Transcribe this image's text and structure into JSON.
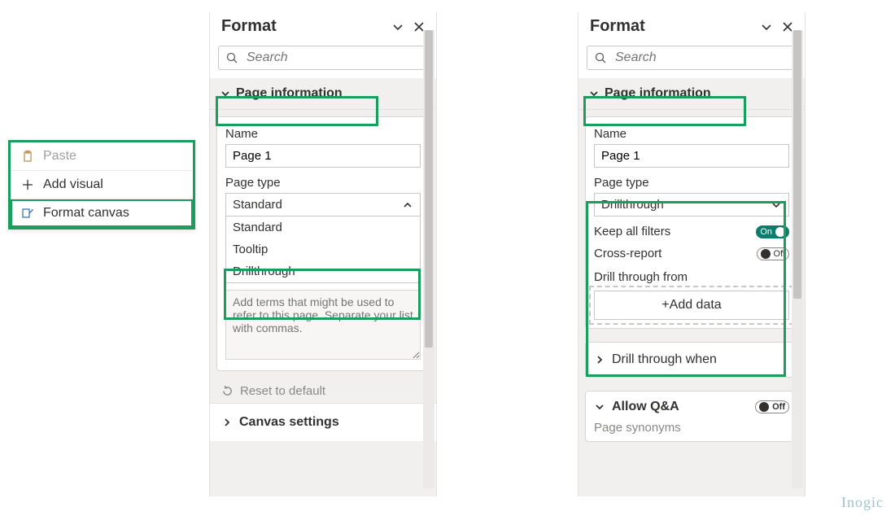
{
  "context_menu": {
    "items": [
      {
        "label": "Paste",
        "disabled": true
      },
      {
        "label": "Add visual",
        "disabled": false
      },
      {
        "label": "Format canvas",
        "disabled": false,
        "highlight": true
      }
    ]
  },
  "search_placeholder": "Search",
  "page_information_label": "Page information",
  "name_label": "Name",
  "page_type_label": "Page type",
  "reset_label": "Reset to default",
  "canvas_settings_label": "Canvas settings",
  "left_pane": {
    "title": "Format",
    "page_name": "Page 1",
    "selected_type": "Standard",
    "options": [
      "Standard",
      "Tooltip",
      "Drillthrough"
    ],
    "synonyms_hint": "Add terms that might be used to refer to this page. Separate your list with commas."
  },
  "right_pane": {
    "title": "Format",
    "page_name": "Page 1",
    "selected_type": "Drillthrough",
    "keep_all_filters_label": "Keep all filters",
    "keep_all_filters": "On",
    "cross_report_label": "Cross-report",
    "cross_report": "Off",
    "drill_through_from_label": "Drill through from",
    "add_data_label": "+Add data",
    "drill_through_when_label": "Drill through when",
    "allow_qna_label": "Allow Q&A",
    "allow_qna": "Off",
    "page_synonyms_label": "Page synonyms"
  },
  "watermark": "Inogic",
  "colors": {
    "accent_green": "#1a9e5e",
    "toggle_on": "#0f7b6c"
  }
}
